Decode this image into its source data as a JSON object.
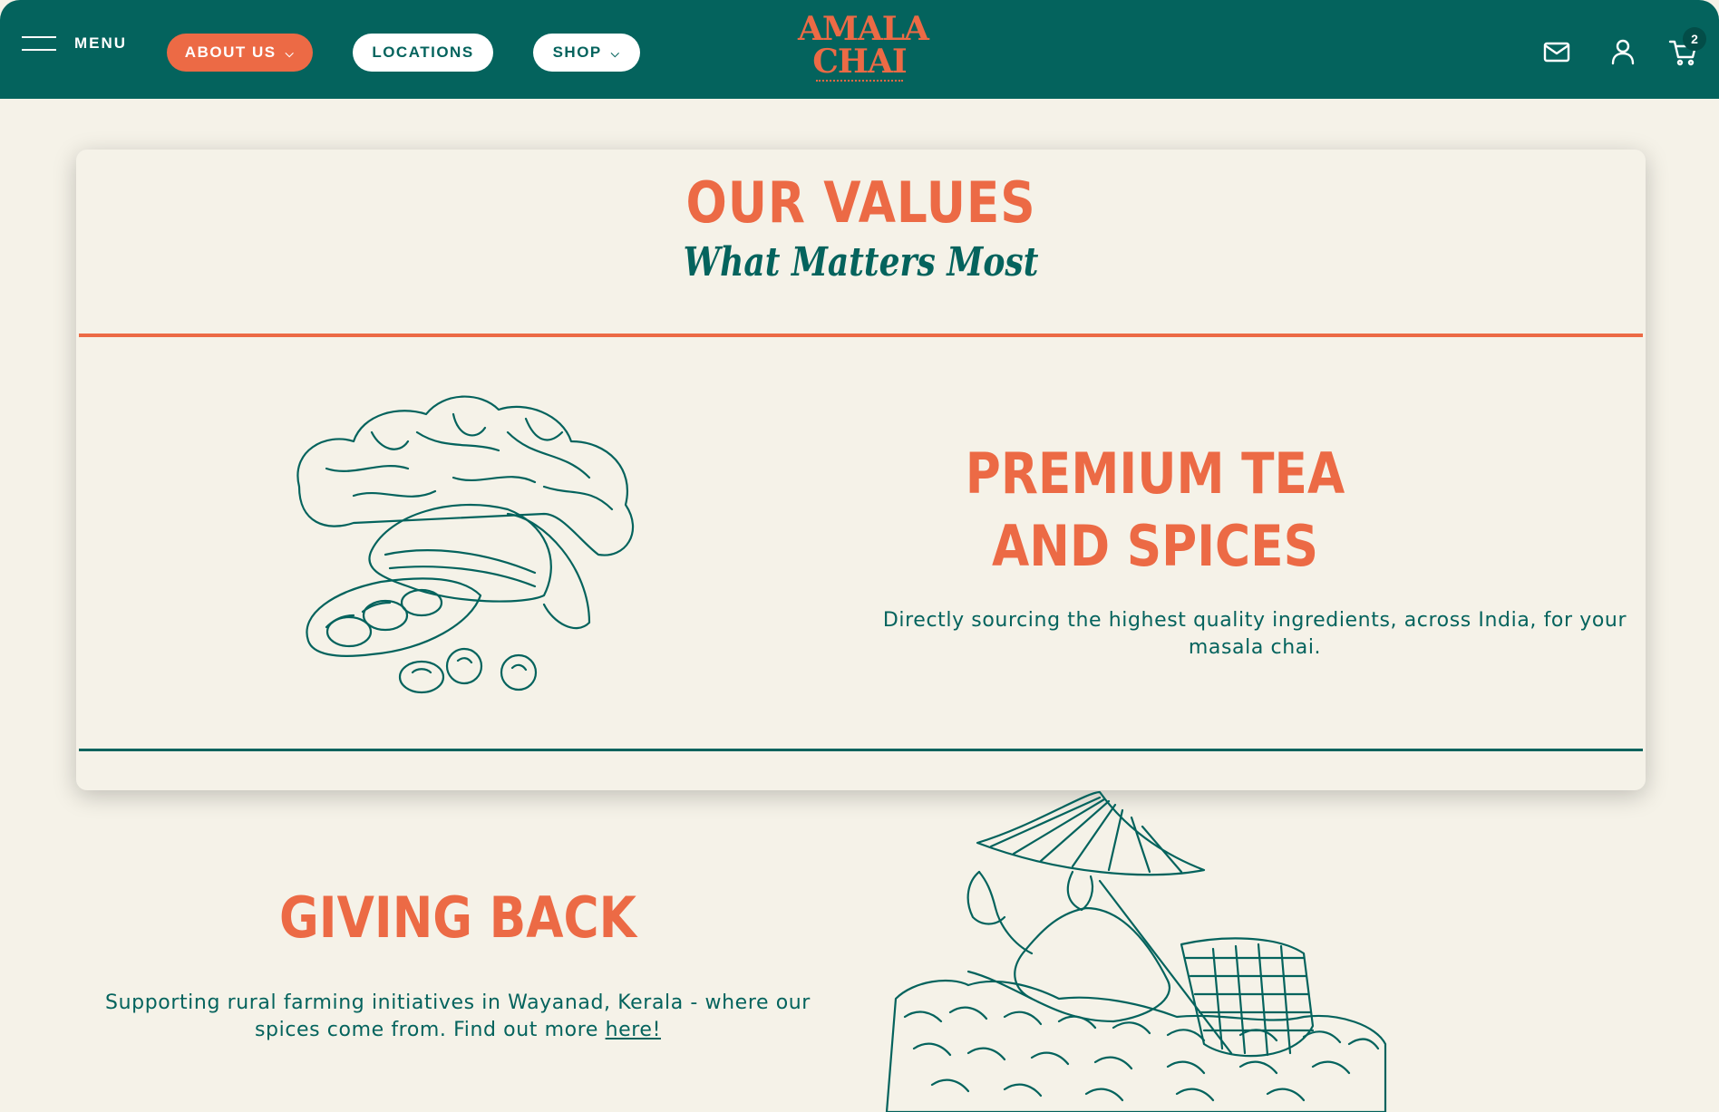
{
  "header": {
    "menu_label": "MENU",
    "nav": {
      "about_label": "ABOUT US",
      "locations_label": "LOCATIONS",
      "shop_label": "SHOP"
    },
    "logo": {
      "line1": "AMALA",
      "line2": "CHAI"
    },
    "icons": [
      "menu-icon",
      "mail-icon",
      "user-icon",
      "cart-icon"
    ],
    "cart_count": "2"
  },
  "values": {
    "title": "OUR VALUES",
    "subtitle": "What Matters Most",
    "premium": {
      "title_line1": "PREMIUM TEA",
      "title_line2": "AND SPICES",
      "text": "Directly sourcing the highest quality ingredients, across India, for your masala chai."
    }
  },
  "giving_back": {
    "title": "GIVING BACK",
    "text": "Supporting rural farming initiatives in Wayanad, Kerala - where our spices come from. Find out more",
    "link_label": "here!"
  },
  "colors": {
    "teal": "#04635d",
    "orange": "#ec6a45",
    "cream": "#f5f2e8"
  }
}
